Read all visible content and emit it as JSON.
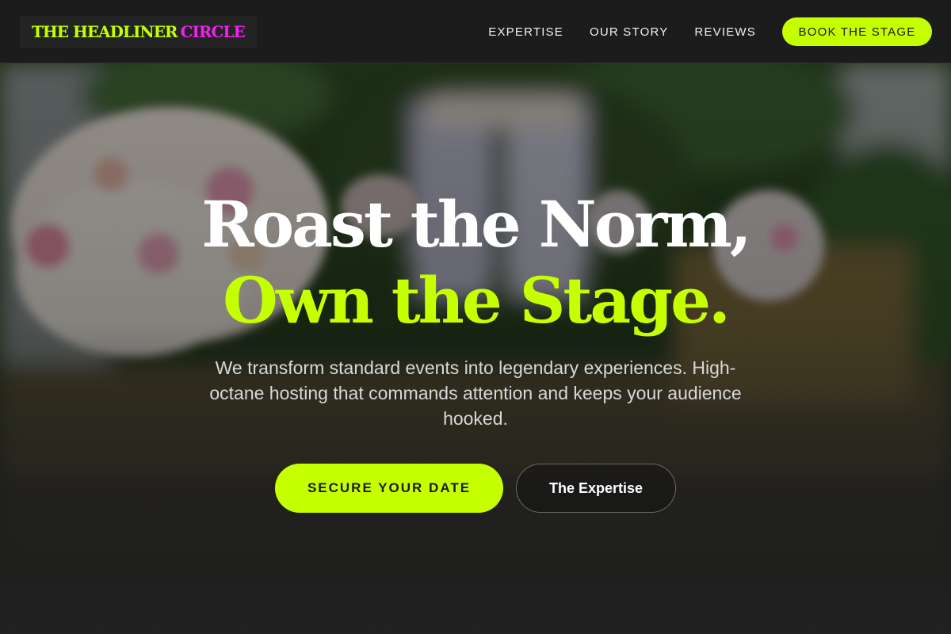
{
  "brand": {
    "name_main": "THE HEADLINER",
    "name_accent": "CIRCLE",
    "accent_color": "#c6ff00",
    "logo_accent_color": "#ee22ee"
  },
  "nav": {
    "links": [
      "EXPERTISE",
      "OUR STORY",
      "REVIEWS"
    ],
    "cta_label": "BOOK THE STAGE"
  },
  "hero": {
    "title_line1": "Roast the Norm,",
    "title_line2": "Own the Stage.",
    "subtitle": "We transform standard events into legendary experiences. High-octane hosting that commands attention and keeps your audience hooked.",
    "primary_button": "SECURE YOUR DATE",
    "secondary_button": "The Expertise",
    "background_image": "blurred outdoor wedding ceremony with flower bouquets and arch"
  },
  "colors": {
    "background": "#222222",
    "header_background": "#1c1c1c",
    "text_primary": "#ffffff",
    "text_secondary": "#d8d8d8"
  }
}
